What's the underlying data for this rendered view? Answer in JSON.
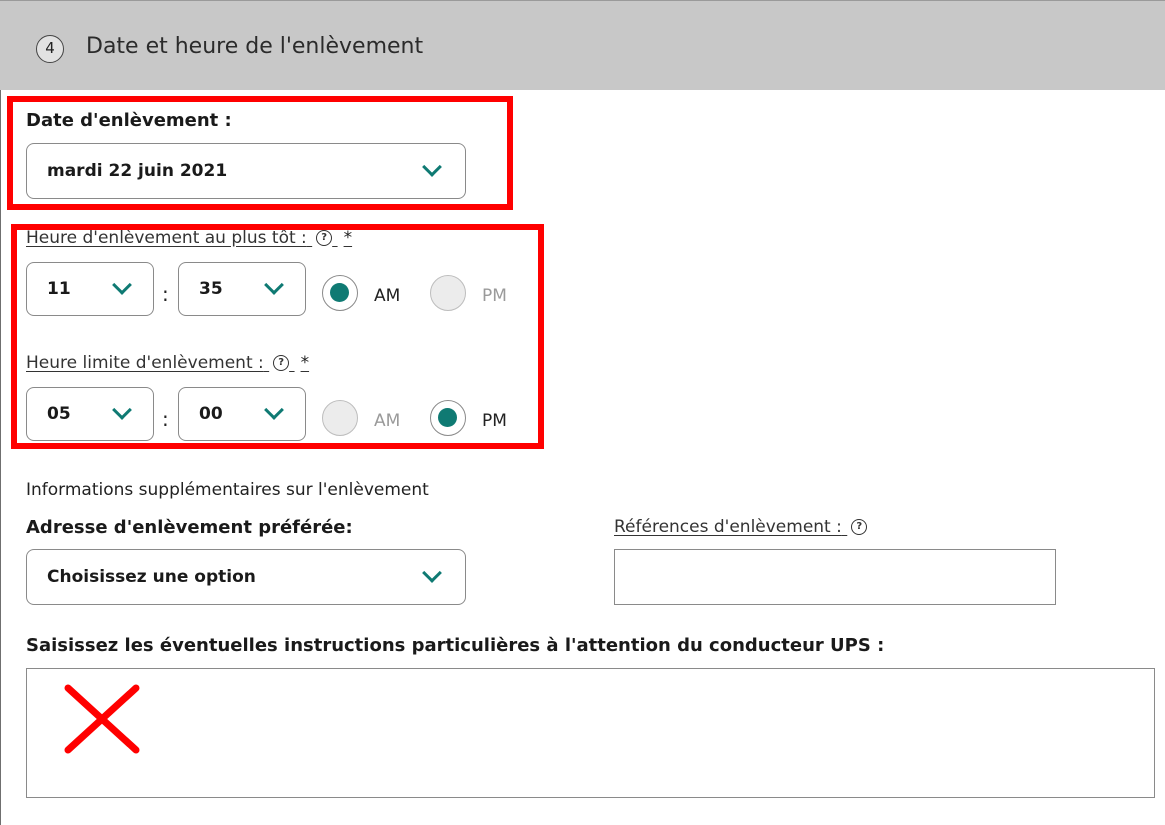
{
  "section": {
    "step_number": "4",
    "title": "Date et heure de l'enlèvement"
  },
  "pickup_date": {
    "label": "Date d'enlèvement :",
    "value": "mardi 22 juin 2021"
  },
  "earliest_time": {
    "label": "Heure d'enlèvement au plus tôt :",
    "help": "?",
    "required": "*",
    "hour": "11",
    "minute": "35",
    "separator": ":",
    "am_label": "AM",
    "pm_label": "PM",
    "selected": "AM"
  },
  "latest_time": {
    "label": "Heure limite d'enlèvement :",
    "help": "?",
    "required": "*",
    "hour": "05",
    "minute": "00",
    "separator": ":",
    "am_label": "AM",
    "pm_label": "PM",
    "selected": "PM"
  },
  "additional": {
    "heading": "Informations supplémentaires sur l'enlèvement",
    "preferred_address_label": "Adresse d'enlèvement préférée:",
    "preferred_address_value": "Choisissez une option",
    "references_label": "Références d'enlèvement :",
    "references_help": "?",
    "references_value": "",
    "instructions_label": "Saisissez les éventuelles instructions particulières à l'attention du conducteur UPS :",
    "instructions_value": ""
  },
  "colors": {
    "accent": "#0f7a73",
    "highlight": "#ff0000",
    "header_bg": "#c8c8c8"
  },
  "icons": {
    "chevron": "chevron-down-icon",
    "help": "help-circle-icon",
    "annotation": "red-x-mark-icon"
  }
}
